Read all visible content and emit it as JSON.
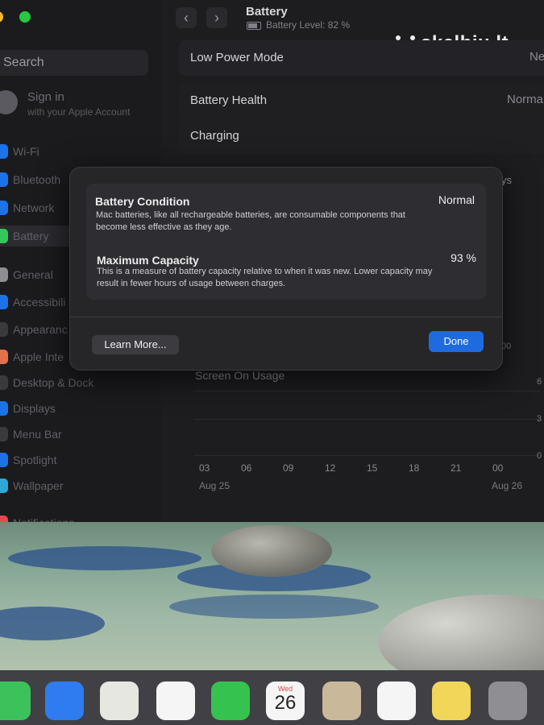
{
  "window": {
    "title": "Battery",
    "battery_level": "Battery Level: 82 %"
  },
  "watermark": "skelbiu.lt",
  "sidebar": {
    "search_placeholder": "Search",
    "account": {
      "title": "Sign in",
      "subtitle": "with your Apple Account"
    },
    "items": [
      {
        "label": "Wi-Fi",
        "icon": "wifi-icon",
        "color": "#1e72e8"
      },
      {
        "label": "Bluetooth",
        "icon": "bluetooth-icon",
        "color": "#1e72e8"
      },
      {
        "label": "Network",
        "icon": "network-icon",
        "color": "#1e72e8"
      },
      {
        "label": "Battery",
        "icon": "battery-icon",
        "color": "#34c759"
      },
      {
        "label": "General",
        "icon": "gear-icon",
        "color": "#8e8e93"
      },
      {
        "label": "Accessibili",
        "icon": "accessibility-icon",
        "color": "#1e72e8"
      },
      {
        "label": "Appearanc",
        "icon": "appearance-icon",
        "color": "#3a3a3c"
      },
      {
        "label": "Apple Inte",
        "icon": "apple-intelligence-icon",
        "color": "#e2704a"
      },
      {
        "label": "Desktop & Dock",
        "icon": "desktop-dock-icon",
        "color": "#3a3a3c"
      },
      {
        "label": "Displays",
        "icon": "displays-icon",
        "color": "#1e72e8"
      },
      {
        "label": "Menu Bar",
        "icon": "menu-bar-icon",
        "color": "#3a3a3c"
      },
      {
        "label": "Spotlight",
        "icon": "spotlight-icon",
        "color": "#1e72e8"
      },
      {
        "label": "Wallpaper",
        "icon": "wallpaper-icon",
        "color": "#2fa6d8"
      },
      {
        "label": "Notifications",
        "icon": "notifications-icon",
        "color": "#e5484d"
      }
    ]
  },
  "settings": {
    "low_power_mode": {
      "label": "Low Power Mode",
      "value": "Neve"
    },
    "battery_health": {
      "label": "Battery Health",
      "value": "Norma"
    },
    "charging": {
      "label": "Charging"
    },
    "partial_value": "ys"
  },
  "chart": {
    "title": "Screen On Usage",
    "x_ticks": [
      "03",
      "06",
      "09",
      "12",
      "15",
      "18",
      "21",
      "00"
    ],
    "day_labels": [
      "Aug 25",
      "Aug 26"
    ],
    "y_ticks": [
      "00",
      "6",
      "3",
      "0"
    ]
  },
  "dialog": {
    "condition": {
      "title": "Battery Condition",
      "value": "Normal",
      "description": "Mac batteries, like all rechargeable batteries, are consumable components that become less effective as they age."
    },
    "capacity": {
      "title": "Maximum Capacity",
      "value": "93 %",
      "description": "This is a measure of battery capacity relative to when it was new. Lower capacity may result in fewer hours of usage between charges."
    },
    "learn_more_label": "Learn More...",
    "done_label": "Done"
  },
  "dock": {
    "apps": [
      {
        "icon": "messages-icon",
        "color": "#3cc25a"
      },
      {
        "icon": "mail-icon",
        "color": "#2f7cf0"
      },
      {
        "icon": "maps-icon",
        "color": "#e7e7e2"
      },
      {
        "icon": "photos-icon",
        "color": "#f5f5f5"
      },
      {
        "icon": "facetime-icon",
        "color": "#36c24f"
      },
      {
        "icon": "calendar-icon",
        "color": "#f5f5f5",
        "day": "Wed",
        "date": "26"
      },
      {
        "icon": "contacts-icon",
        "color": "#c9b89a"
      },
      {
        "icon": "reminders-icon",
        "color": "#f5f5f5"
      },
      {
        "icon": "notes-icon",
        "color": "#f2d65a"
      },
      {
        "icon": "system-settings-icon",
        "color": "#8e8e93"
      }
    ]
  }
}
